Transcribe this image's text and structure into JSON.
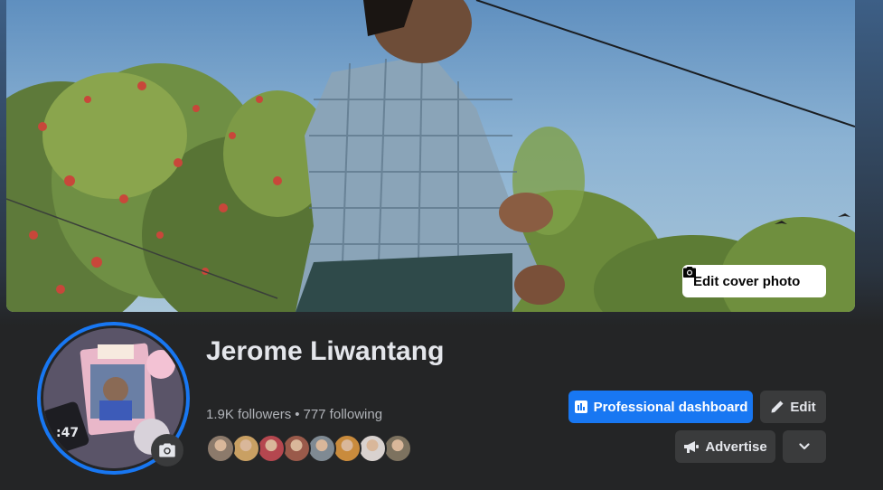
{
  "cover": {
    "edit_cover_label": "Edit cover photo"
  },
  "profile": {
    "name": "Jerome Liwantang",
    "followers": "1.9K followers",
    "separator": "•",
    "following": "777 following"
  },
  "friends": [
    {
      "color": "#8c7a6b"
    },
    {
      "color": "#c9a063"
    },
    {
      "color": "#b5474f"
    },
    {
      "color": "#9a5a4a"
    },
    {
      "color": "#7f8a93"
    },
    {
      "color": "#c98b3c"
    },
    {
      "color": "#d9d2cf"
    },
    {
      "color": "#7d725f"
    }
  ],
  "actions": {
    "professional_dashboard": "Professional dashboard",
    "edit": "Edit",
    "advertise": "Advertise"
  },
  "icons": {
    "camera": "camera-icon",
    "chart": "chart-icon",
    "pencil": "pencil-icon",
    "megaphone": "megaphone-icon",
    "chevron": "chevron-down-icon"
  },
  "colors": {
    "accent": "#1877f2",
    "background": "#242526",
    "secondary_button": "#3a3b3c"
  }
}
